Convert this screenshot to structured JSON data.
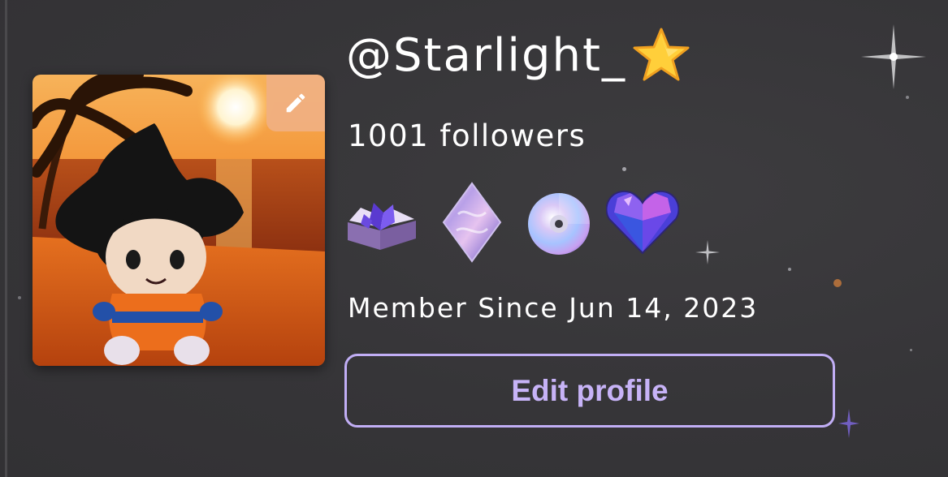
{
  "profile": {
    "username": "@Starlight_",
    "followers_text": "1001 followers",
    "member_since": "Member Since Jun 14, 2023",
    "edit_profile_label": "Edit profile"
  },
  "badges": [
    {
      "icon": "crystal-book-icon"
    },
    {
      "icon": "holographic-diamond-icon"
    },
    {
      "icon": "holographic-disc-icon"
    },
    {
      "icon": "gem-heart-icon"
    }
  ],
  "colors": {
    "background": "#363538",
    "text": "#ffffff",
    "accent": "#c1aef5",
    "edit_avatar_button": "#f0b082"
  }
}
